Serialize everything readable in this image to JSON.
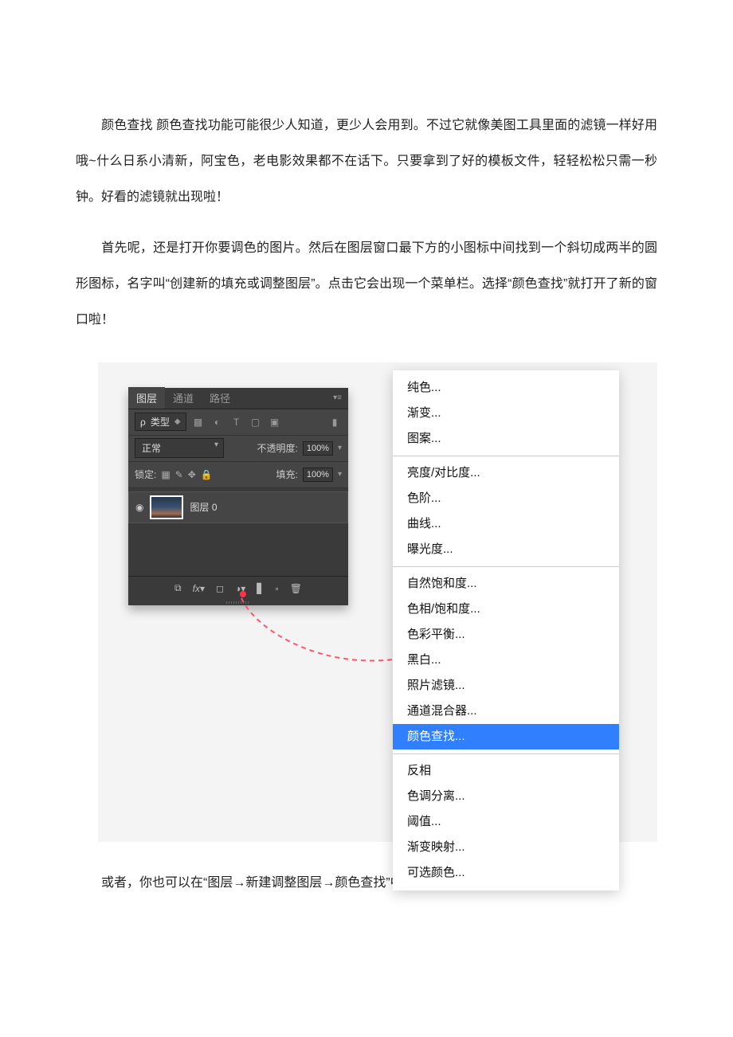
{
  "paragraphs": {
    "p1": "颜色查找 颜色查找功能可能很少人知道，更少人会用到。不过它就像美图工具里面的滤镜一样好用哦~什么日系小清新，阿宝色，老电影效果都不在话下。只要拿到了好的模板文件，轻轻松松只需一秒钟。好看的滤镜就出现啦！",
    "p2": "首先呢，还是打开你要调色的图片。然后在图层窗口最下方的小图标中间找到一个斜切成两半的圆形图标，名字叫“创建新的填充或调整图层”。点击它会出现一个菜单栏。选择“颜色查找”就打开了新的窗口啦！",
    "p3": "或者，你也可以在“图层→新建调整图层→颜色查找”中调出这个命令"
  },
  "layersPanel": {
    "tabs": {
      "layers": "图层",
      "channels": "通道",
      "paths": "路径"
    },
    "filterLabel": "类型",
    "filterIcon": "ρ",
    "blendMode": "正常",
    "opacityLabel": "不透明度:",
    "opacityValue": "100%",
    "lockLabel": "锁定:",
    "fillLabel": "填充:",
    "fillValue": "100%",
    "layerName": "图层 0"
  },
  "contextMenu": {
    "group1": [
      "纯色...",
      "渐变...",
      "图案..."
    ],
    "group2": [
      "亮度/对比度...",
      "色阶...",
      "曲线...",
      "曝光度..."
    ],
    "group3": [
      "自然饱和度...",
      "色相/饱和度...",
      "色彩平衡...",
      "黑白...",
      "照片滤镜...",
      "通道混合器...",
      "颜色查找..."
    ],
    "group4": [
      "反相",
      "色调分离...",
      "阈值...",
      "渐变映射...",
      "可选颜色..."
    ],
    "selected": "颜色查找..."
  }
}
